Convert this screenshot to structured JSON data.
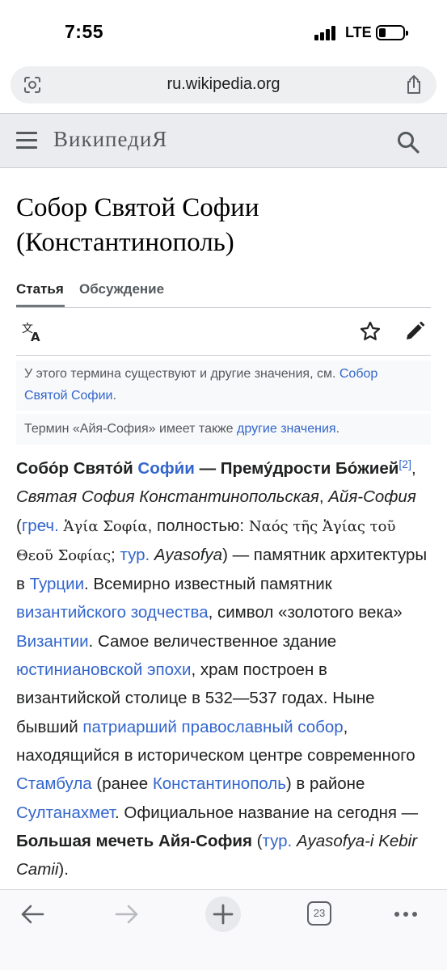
{
  "status_bar": {
    "time": "7:55",
    "network": "LTE"
  },
  "browser": {
    "url": "ru.wikipedia.org",
    "open_tabs": "23"
  },
  "header": {
    "wordmark": "ВикипедиЯ"
  },
  "page": {
    "title": "Собор Святой Софии (Константинополь)",
    "tabs": [
      {
        "label": "Статья"
      },
      {
        "label": "Обсуждение"
      }
    ]
  },
  "hatnotes": {
    "h1_text": "У этого термина существуют и другие значения, см.",
    "h1_link": "Собор Святой Софии",
    "h1_end": ".",
    "h2_text": "Термин «Айя-София» имеет также ",
    "h2_link": "другие значения",
    "h2_end": "."
  },
  "article": {
    "s1": "Собо́р Свято́й ",
    "s2": "Софи́и",
    "s3": " — Прему́дрости Бо́жией",
    "s4": "[2]",
    "s5": ", ",
    "s6": "Святая София Константинопольская",
    "s7": ", ",
    "s8": "Айя-София",
    "s9": " (",
    "s10": "греч.",
    "s11": " ",
    "s12": "Ἁγία Σοφία",
    "s13": ", полностью: ",
    "s14": "Ναός τῆς Ἁγίας τοῦ Θεοῦ Σοφίας",
    "s15": "; ",
    "s16": "тур.",
    "s17": " ",
    "s18": "Ayasofya",
    "s19": ") — памятник архитектуры в ",
    "s20": "Турции",
    "s21": ". Всемирно известный памятник ",
    "s22": "византийского зодчества",
    "s23": ", символ «золотого века» ",
    "s24": "Византии",
    "s25": ". Самое величественное здание ",
    "s26": "юстиниановской эпохи",
    "s27": ", храм построен в византийской столице в 532—537 годах. Ныне бывший ",
    "s28": "патриарший православный собор",
    "s29": ", находящийся в историческом центре современного ",
    "s30": "Стамбула",
    "s31": " (ранее ",
    "s32": "Константинополь",
    "s33": ") в районе ",
    "s34": "Султанахмет",
    "s35": ". Официальное название на сегодня — ",
    "s36": "Большая мечеть Айя-София",
    "s37": " (",
    "s38": "тур.",
    "s39": " ",
    "s40": "Ayasofya-i Kebir Camii",
    "s41": ")."
  },
  "colors": {
    "link": "#3366cc",
    "header_bg": "#eaecf0",
    "text": "#202122"
  },
  "icons": [
    "signal-icon",
    "battery-icon",
    "page-scan-icon",
    "share-icon",
    "menu-icon",
    "search-icon",
    "translate-icon",
    "star-icon",
    "edit-icon",
    "back-icon",
    "forward-icon",
    "plus-icon",
    "more-icon"
  ]
}
